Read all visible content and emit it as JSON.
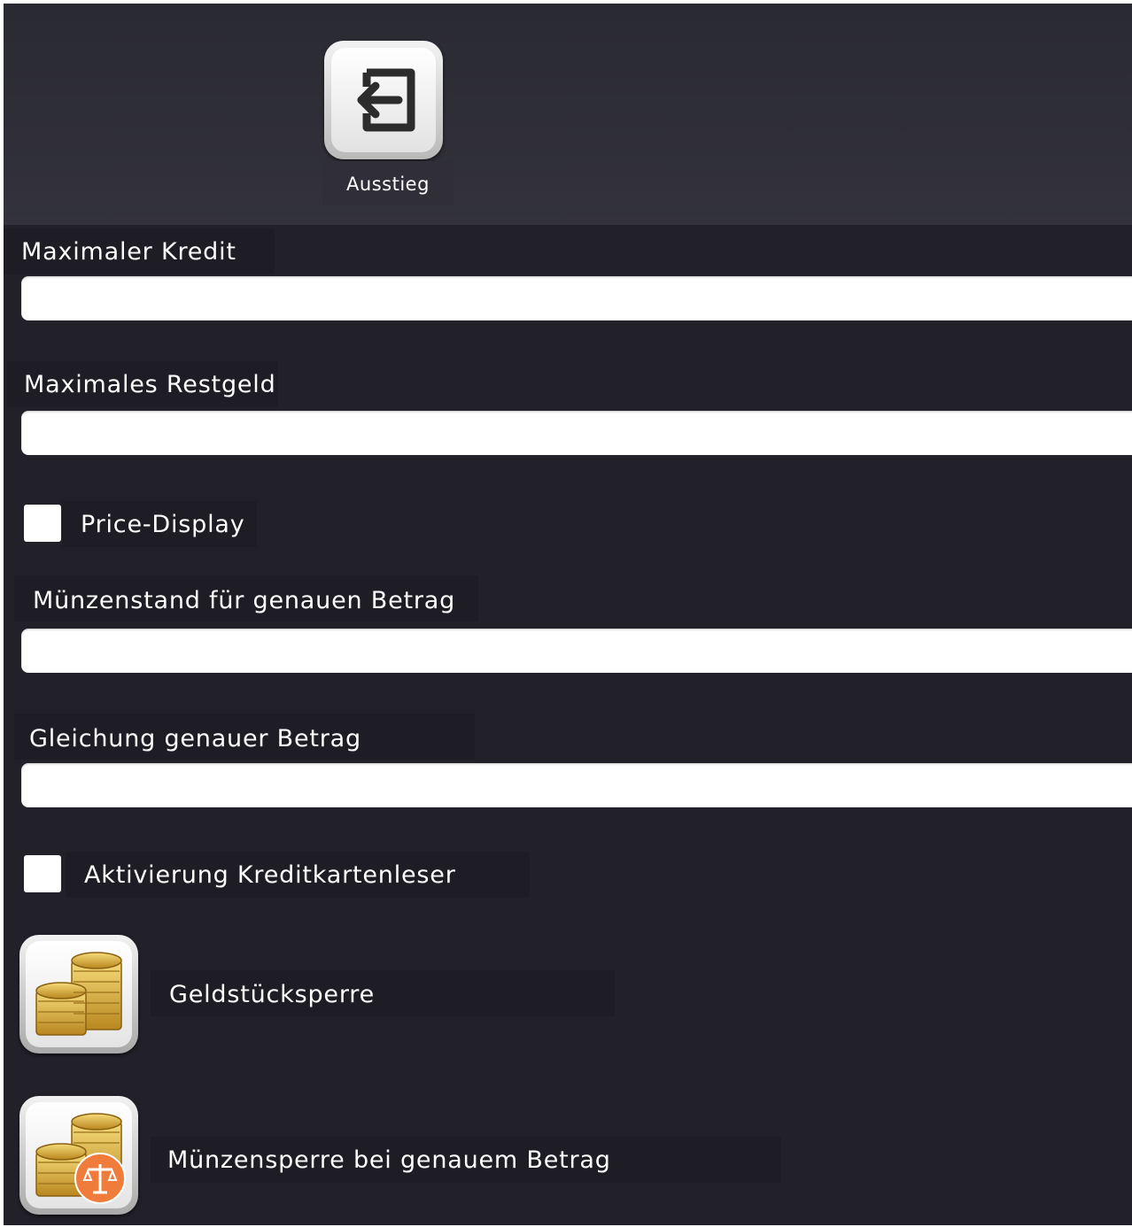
{
  "toolbar": {
    "exit_label": "Ausstieg",
    "exit_icon": "exit-arrow-icon"
  },
  "form": {
    "max_credit": {
      "label": "Maximaler Kredit",
      "value": ""
    },
    "max_change": {
      "label": "Maximales Restgeld",
      "value": ""
    },
    "price_display": {
      "label": "Price-Display",
      "checked": false
    },
    "coin_level_exact": {
      "label": "Münzenstand für genauen Betrag",
      "value": ""
    },
    "equation_exact": {
      "label": "Gleichung genauer Betrag",
      "value": ""
    },
    "card_reader": {
      "label": "Aktivierung Kreditkartenleser",
      "checked": false
    }
  },
  "actions": {
    "coin_lock": {
      "label": "Geldstücksperre",
      "icon": "coin-stack-icon"
    },
    "coin_lock_exact": {
      "label": "Münzensperre bei genauem Betrag",
      "icon": "coin-stack-scale-icon"
    }
  },
  "colors": {
    "background": "#22212a",
    "top_bar": "#33323d",
    "label_bg": "#1e1d25",
    "badge_orange": "#f07c3c",
    "coin_gold": "#e0b440"
  }
}
